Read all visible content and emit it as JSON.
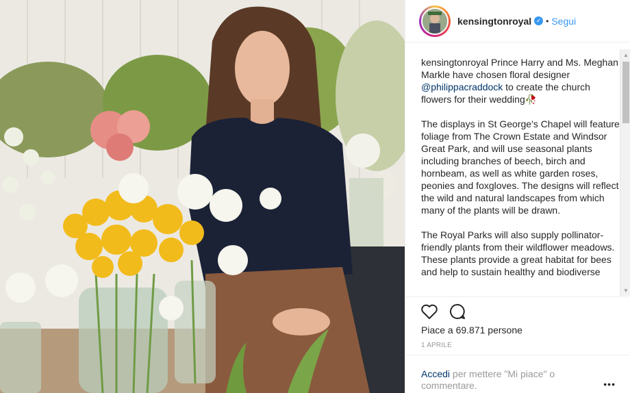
{
  "post": {
    "username": "kensingtonroyal",
    "follow_label": "Segui",
    "separator": "•",
    "caption": {
      "username": "kensingtonroyal",
      "p1_before": " Prince Harry and Ms. Meghan Markle have chosen floral designer ",
      "mention": "@philippacraddock",
      "p1_after": " to create the church flowers for their wedding",
      "emoji": "🥀",
      "p2": "The displays in St George's Chapel will feature foliage from The Crown Estate and Windsor Great Park, and will use seasonal plants including branches of beech, birch and hornbeam, as well as white garden roses, peonies and foxgloves. The designs will reflect the wild and natural landscapes from which many of the plants will be drawn.",
      "p3": "The Royal Parks will also supply pollinator-friendly plants from their wildflower meadows. These plants provide a great habitat for bees and help to sustain healthy and biodiverse"
    },
    "likes_text": "Piace a 69.871 persone",
    "date": "1 APRILE",
    "login": {
      "link": "Accedi",
      "rest": " per mettere \"Mi piace\" o commentare."
    },
    "more_label": "•••",
    "icons": {
      "like": "heart-icon",
      "comment": "comment-icon",
      "verified": "verified-badge-icon"
    },
    "colors": {
      "link": "#3897f0",
      "mention": "#003569",
      "text": "#262626",
      "muted": "#999999"
    }
  }
}
